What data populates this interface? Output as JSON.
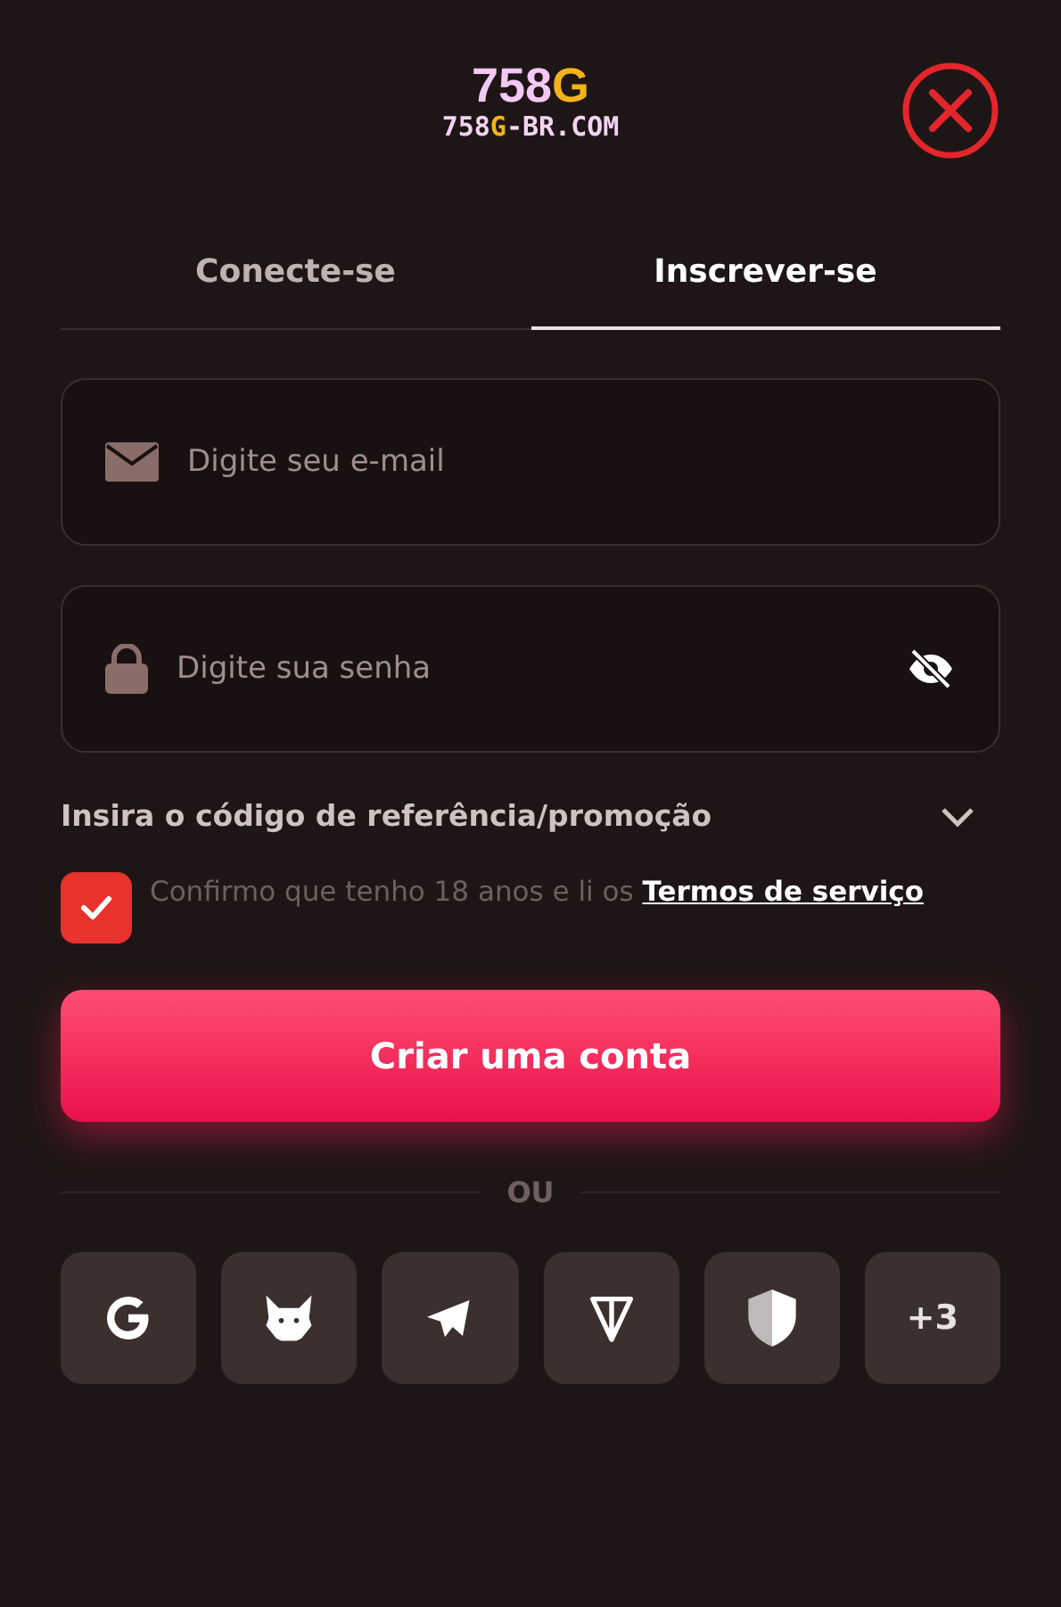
{
  "logo": {
    "title": [
      {
        "text": "758",
        "accent": false
      },
      {
        "text": "G",
        "accent": true
      }
    ],
    "domain": [
      {
        "text": "758",
        "accent": false
      },
      {
        "text": "G",
        "accent": true
      },
      {
        "text": "-BR.COM",
        "accent": false
      }
    ]
  },
  "tabs": [
    {
      "label": "Conecte-se",
      "selected": false
    },
    {
      "label": "Inscrever-se",
      "selected": true
    }
  ],
  "fields": [
    {
      "kind": "email",
      "placeholder": "Digite seu e-mail"
    },
    {
      "kind": "password",
      "placeholder": "Digite sua senha"
    }
  ],
  "referral": {
    "label": "Insira o código de referência/promoção",
    "expanded": false
  },
  "terms": {
    "checked": true,
    "text": "Confirmo que tenho 18 anos e li os ",
    "link": "Termos de serviço"
  },
  "submit": "Criar uma conta",
  "divider": "OU",
  "social": [
    {
      "kind": "google"
    },
    {
      "kind": "fox"
    },
    {
      "kind": "telegram"
    },
    {
      "kind": "ton"
    },
    {
      "kind": "shield"
    },
    {
      "kind": "more",
      "label": "+3"
    }
  ]
}
